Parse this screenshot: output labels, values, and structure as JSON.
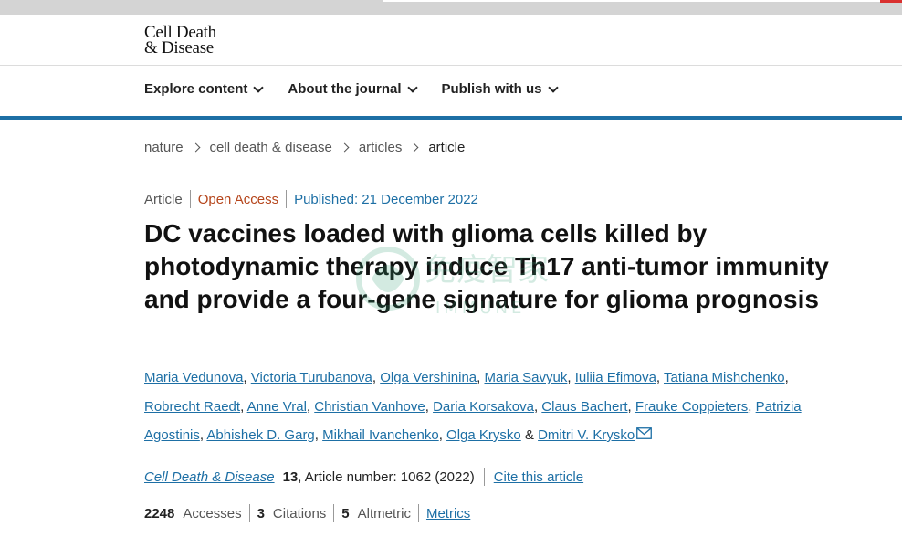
{
  "logo": {
    "line1": "Cell Death",
    "line2": "& Disease"
  },
  "nav": [
    {
      "label": "Explore content"
    },
    {
      "label": "About the journal"
    },
    {
      "label": "Publish with us"
    }
  ],
  "breadcrumb": [
    "nature",
    "cell death & disease",
    "articles",
    "article"
  ],
  "meta": {
    "type": "Article",
    "access": "Open Access",
    "published": "Published: 21 December 2022"
  },
  "title": "DC vaccines loaded with glioma cells killed by photodynamic therapy induce Th17 anti-tumor immunity and provide a four-gene signature for glioma prognosis",
  "authors": [
    "Maria Vedunova",
    "Victoria Turubanova",
    "Olga Vershinina",
    "Maria Savyuk",
    "Iuliia Efimova",
    "Tatiana Mishchenko",
    "Robrecht Raedt",
    "Anne Vral",
    "Christian Vanhove",
    "Daria Korsakova",
    "Claus Bachert",
    "Frauke Coppieters",
    "Patrizia Agostinis",
    "Abhishek D. Garg",
    "Mikhail Ivanchenko",
    "Olga Krysko",
    "Dmitri V. Krysko"
  ],
  "authors_text": {
    "comma": ", ",
    "and": " & "
  },
  "icons": {
    "mail": "mail-icon",
    "watermark": "watermark-logo"
  },
  "watermark": {
    "text1": "免疫智家",
    "text2": "IMMUNE"
  },
  "journal": {
    "name": "Cell Death & Disease",
    "volume": "13",
    "article_number": ", Article number: 1062 (2022)",
    "cite": "Cite this article"
  },
  "metrics": {
    "accesses_value": "2248",
    "accesses_label": "Accesses",
    "citations_value": "3",
    "citations_label": "Citations",
    "altmetric_value": "5",
    "altmetric_label": "Altmetric",
    "metrics_link": "Metrics"
  },
  "colors": {
    "link": "#1d6fa5",
    "open_access": "#b5451b",
    "accent_bar": "#1d6fa5"
  }
}
